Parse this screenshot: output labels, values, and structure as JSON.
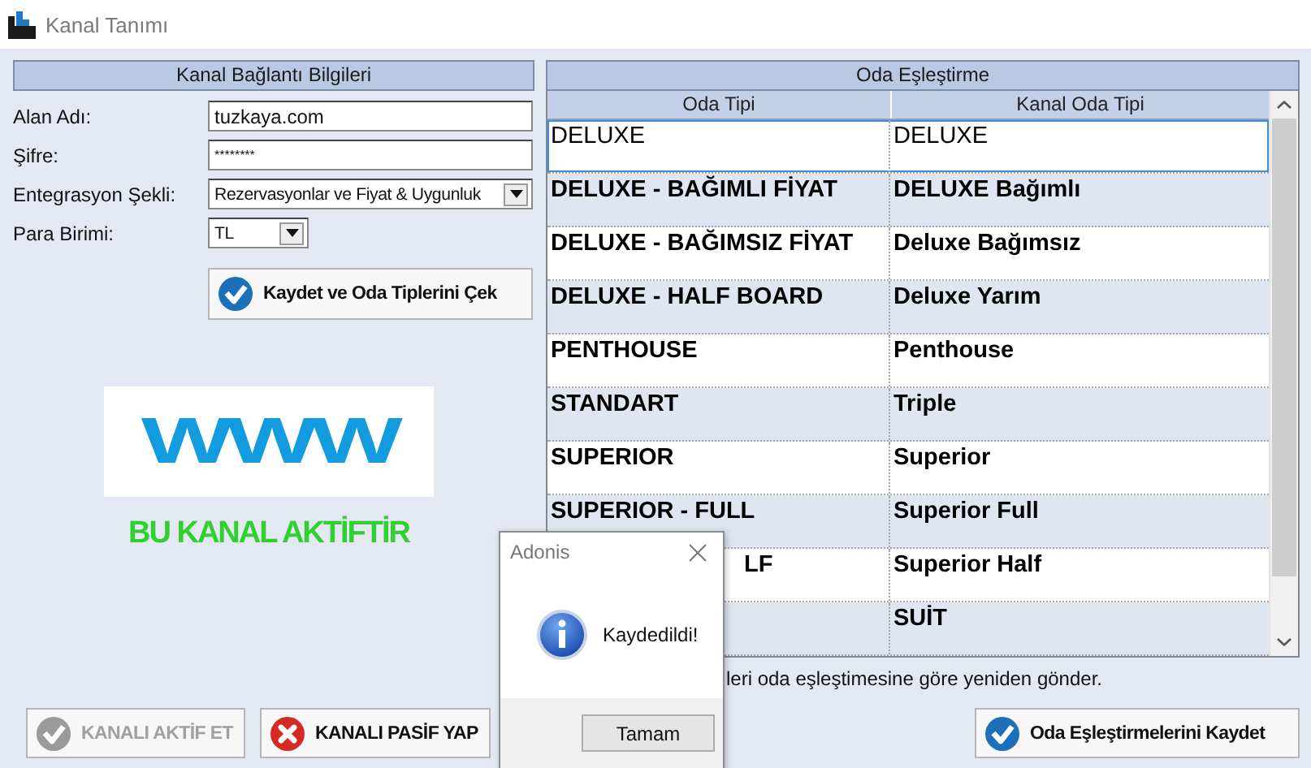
{
  "window": {
    "title": "Kanal Tanımı"
  },
  "connection": {
    "title": "Kanal Bağlantı Bilgileri",
    "fields": [
      {
        "kind": "text",
        "label": "Alan Adı:",
        "value": "tuzkaya.com"
      },
      {
        "kind": "password",
        "label": "Şifre:",
        "value": "********"
      },
      {
        "kind": "dropdown",
        "label": "Entegrasyon Şekli:",
        "value": "Rezervasyonlar ve Fiyat & Uygunluk"
      },
      {
        "kind": "dropdown",
        "label": "Para Birimi:",
        "value": "TL"
      }
    ],
    "fetch_button": "Kaydet ve Oda Tiplerini Çek",
    "logo": "WWW",
    "status": "BU KANAL AKTİFTİR",
    "actions": [
      {
        "kind": "activate",
        "label": "KANALI AKTİF ET",
        "disabled": true
      },
      {
        "kind": "deactivate",
        "label": "KANALI PASİF YAP",
        "disabled": false
      }
    ]
  },
  "mapping": {
    "title": "Oda Eşleştirme",
    "columns": [
      "Oda Tipi",
      "Kanal Oda Tipi"
    ],
    "rows": [
      {
        "oda_tipi": "DELUXE",
        "kanal_oda_tipi": "DELUXE",
        "selected": true
      },
      {
        "oda_tipi": "DELUXE - BAĞIMLI FİYAT",
        "kanal_oda_tipi": "DELUXE Bağımlı",
        "selected": false
      },
      {
        "oda_tipi": "DELUXE - BAĞIMSIZ FİYAT",
        "kanal_oda_tipi": "Deluxe Bağımsız",
        "selected": false
      },
      {
        "oda_tipi": "DELUXE - HALF BOARD",
        "kanal_oda_tipi": "Deluxe Yarım",
        "selected": false
      },
      {
        "oda_tipi": "PENTHOUSE",
        "kanal_oda_tipi": "Penthouse",
        "selected": false
      },
      {
        "oda_tipi": "STANDART",
        "kanal_oda_tipi": "Triple",
        "selected": false
      },
      {
        "oda_tipi": "SUPERIOR",
        "kanal_oda_tipi": "Superior",
        "selected": false
      },
      {
        "oda_tipi": "SUPERIOR - FULL",
        "kanal_oda_tipi": "Superior Full",
        "selected": false
      },
      {
        "oda_tipi": "LF",
        "kanal_oda_tipi": "Superior Half",
        "selected": false,
        "covered": true
      },
      {
        "kanal_oda_tipi": "SUİT",
        "selected": false
      }
    ],
    "resend_note": "leri oda eşleştimesine göre yeniden gönder.",
    "save_button": "Oda Eşleştirmelerini Kaydet"
  },
  "dialog": {
    "title": "Adonis",
    "message": "Kaydedildi!",
    "button": "Tamam"
  }
}
